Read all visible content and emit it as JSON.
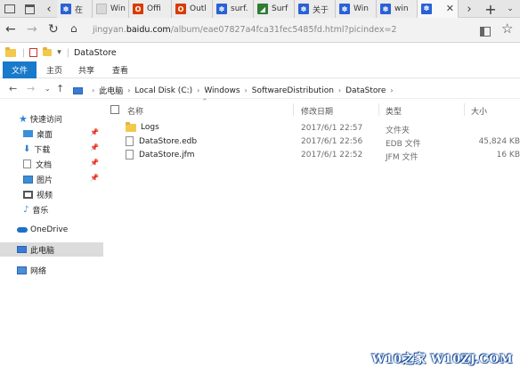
{
  "browser": {
    "tabs": [
      {
        "label": "在",
        "icon": "baidu-paw-icon",
        "color": "#2b61d6"
      },
      {
        "label": "Win",
        "icon": "edge-favicon",
        "color": "#d9d9d9"
      },
      {
        "label": "Offi",
        "icon": "office-icon",
        "color": "#d83b01"
      },
      {
        "label": "Outl",
        "icon": "office-icon",
        "color": "#d83b01"
      },
      {
        "label": "surf.",
        "icon": "baidu-paw-icon",
        "color": "#2b61d6"
      },
      {
        "label": "Surf",
        "icon": "surface-icon",
        "color": "#2e7d32"
      },
      {
        "label": "关于",
        "icon": "baidu-paw-icon",
        "color": "#2b61d6"
      },
      {
        "label": "Win",
        "icon": "baidu-paw-icon",
        "color": "#2b61d6"
      },
      {
        "label": "win",
        "icon": "baidu-paw-icon",
        "color": "#2b61d6"
      },
      {
        "label": "",
        "icon": "baidu-paw-icon",
        "color": "#2b61d6"
      }
    ],
    "url_prefix": "jingyan.",
    "url_domain": "baidu.com",
    "url_path": "/album/eae07827a4fca31fec5485fd.html?picindex=2"
  },
  "explorer": {
    "title": "DataStore",
    "ribbon_tabs": [
      "文件",
      "主页",
      "共享",
      "查看"
    ],
    "breadcrumb": [
      "此电脑",
      "Local Disk (C:)",
      "Windows",
      "SoftwareDistribution",
      "DataStore"
    ],
    "columns": {
      "name": "名称",
      "modified": "修改日期",
      "type": "类型",
      "size": "大小"
    },
    "files": [
      {
        "name": "Logs",
        "modified": "2017/6/1 22:57",
        "type": "文件夹",
        "size": "",
        "icon": "folder-icon"
      },
      {
        "name": "DataStore.edb",
        "modified": "2017/6/1 22:56",
        "type": "EDB 文件",
        "size": "45,824 KB",
        "icon": "file-icon"
      },
      {
        "name": "DataStore.jfm",
        "modified": "2017/6/1 22:52",
        "type": "JFM 文件",
        "size": "16 KB",
        "icon": "file-icon"
      }
    ],
    "nav": {
      "quick_access": "快速访问",
      "quick_items": [
        {
          "label": "桌面",
          "icon": "desktop-icon",
          "color": "#3d8fd8"
        },
        {
          "label": "下载",
          "icon": "download-icon",
          "color": "#2f7fc8"
        },
        {
          "label": "文档",
          "icon": "documents-icon",
          "color": "#8a8a8a"
        },
        {
          "label": "图片",
          "icon": "pictures-icon",
          "color": "#3b8ed8"
        },
        {
          "label": "视频",
          "icon": "videos-icon",
          "color": "#555555"
        },
        {
          "label": "音乐",
          "icon": "music-icon",
          "color": "#3b8ed8"
        }
      ],
      "onedrive": "OneDrive",
      "this_pc": "此电脑",
      "network": "网络"
    }
  },
  "watermark": "W10之家 W10ZJ.COM"
}
